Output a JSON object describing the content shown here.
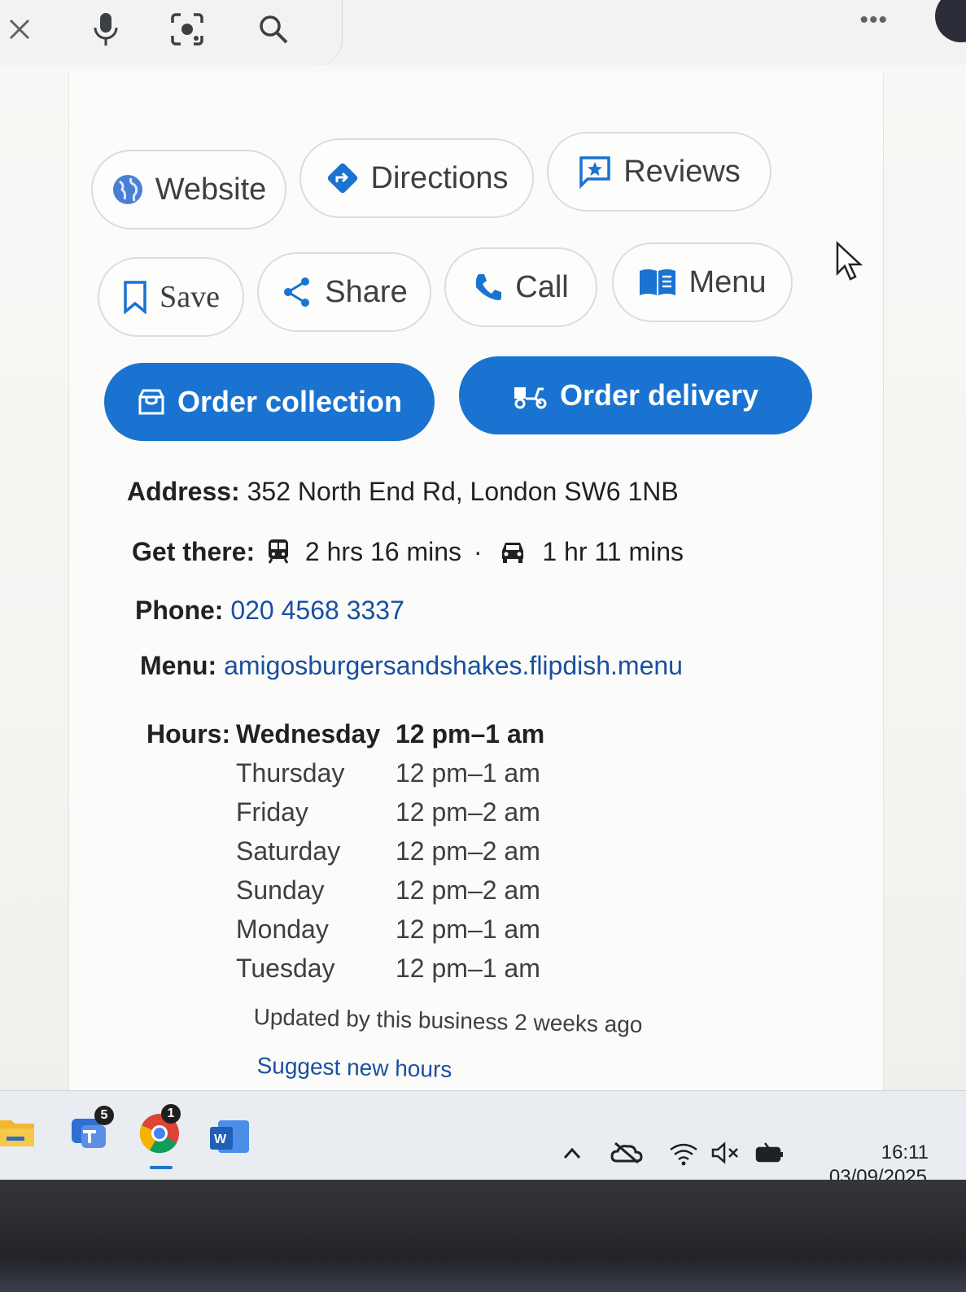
{
  "actions": {
    "website": "Website",
    "directions": "Directions",
    "reviews": "Reviews",
    "save": "Save",
    "share": "Share",
    "call": "Call",
    "menu": "Menu",
    "order_collection": "Order collection",
    "order_delivery": "Order delivery"
  },
  "details": {
    "address_label": "Address:",
    "address": "352 North End Rd, London SW6 1NB",
    "get_there_label": "Get there:",
    "transit_time": "2 hrs 16 mins",
    "separator": "·",
    "drive_time": "1 hr 11 mins",
    "phone_label": "Phone:",
    "phone": "020 4568 3337",
    "menu_label": "Menu:",
    "menu_url": "amigosburgersandshakes.flipdish.menu"
  },
  "hours": {
    "label": "Hours:",
    "rows": [
      {
        "day": "Wednesday",
        "time": "12 pm–1 am"
      },
      {
        "day": "Thursday",
        "time": "12 pm–1 am"
      },
      {
        "day": "Friday",
        "time": "12 pm–2 am"
      },
      {
        "day": "Saturday",
        "time": "12 pm–2 am"
      },
      {
        "day": "Sunday",
        "time": "12 pm–2 am"
      },
      {
        "day": "Monday",
        "time": "12 pm–1 am"
      },
      {
        "day": "Tuesday",
        "time": "12 pm–1 am"
      }
    ],
    "updated": "Updated by this business 2 weeks ago",
    "suggest": "Suggest new hours"
  },
  "taskbar": {
    "teams_badge": "5",
    "chrome_badge": "1",
    "word_letter": "W",
    "time": "16:11",
    "date": "03/09/2025"
  },
  "colors": {
    "primary_blue": "#1a73d0",
    "link_blue": "#1a4fa0",
    "text": "#202124",
    "border": "#dadce0"
  }
}
